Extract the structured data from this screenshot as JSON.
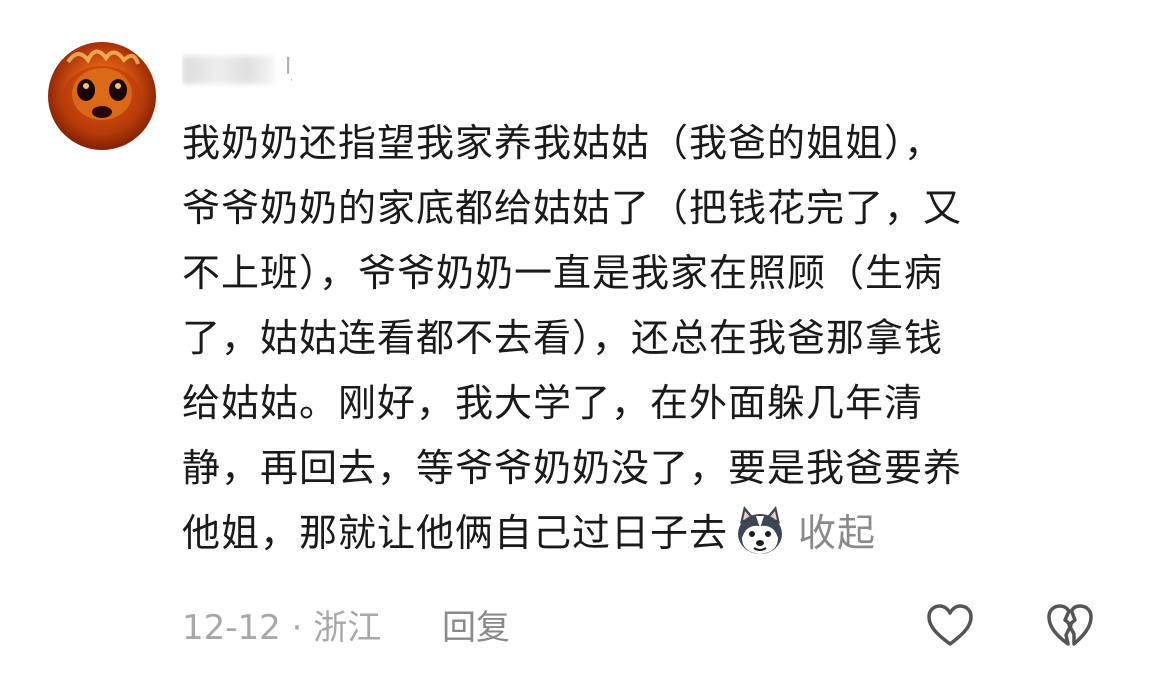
{
  "comment": {
    "username_visible_tail": "刂",
    "avatar_icon": "avatar-fire-creature",
    "lines": [
      "我奶奶还指望我家养我姑姑（我爸的姐姐），",
      "爷爷奶奶的家底都给姑姑了（把钱花完了，又",
      "不上班），爷爷奶奶一直是我家在照顾（生病",
      "了，姑姑连看都不去看），还总在我爸那拿钱",
      "给姑姑。刚好，我大学了，在外面躲几年清",
      "静，再回去，等爷爷奶奶没了，要是我爸要养",
      "他姐，那就让他俩自己过日子去"
    ],
    "emoji": "husky-dog-emoji",
    "collapse_label": "收起",
    "date": "12-12",
    "separator": "·",
    "location": "浙江",
    "reply_label": "回复",
    "like_icon": "heart-outline-icon",
    "dislike_icon": "broken-heart-icon"
  }
}
